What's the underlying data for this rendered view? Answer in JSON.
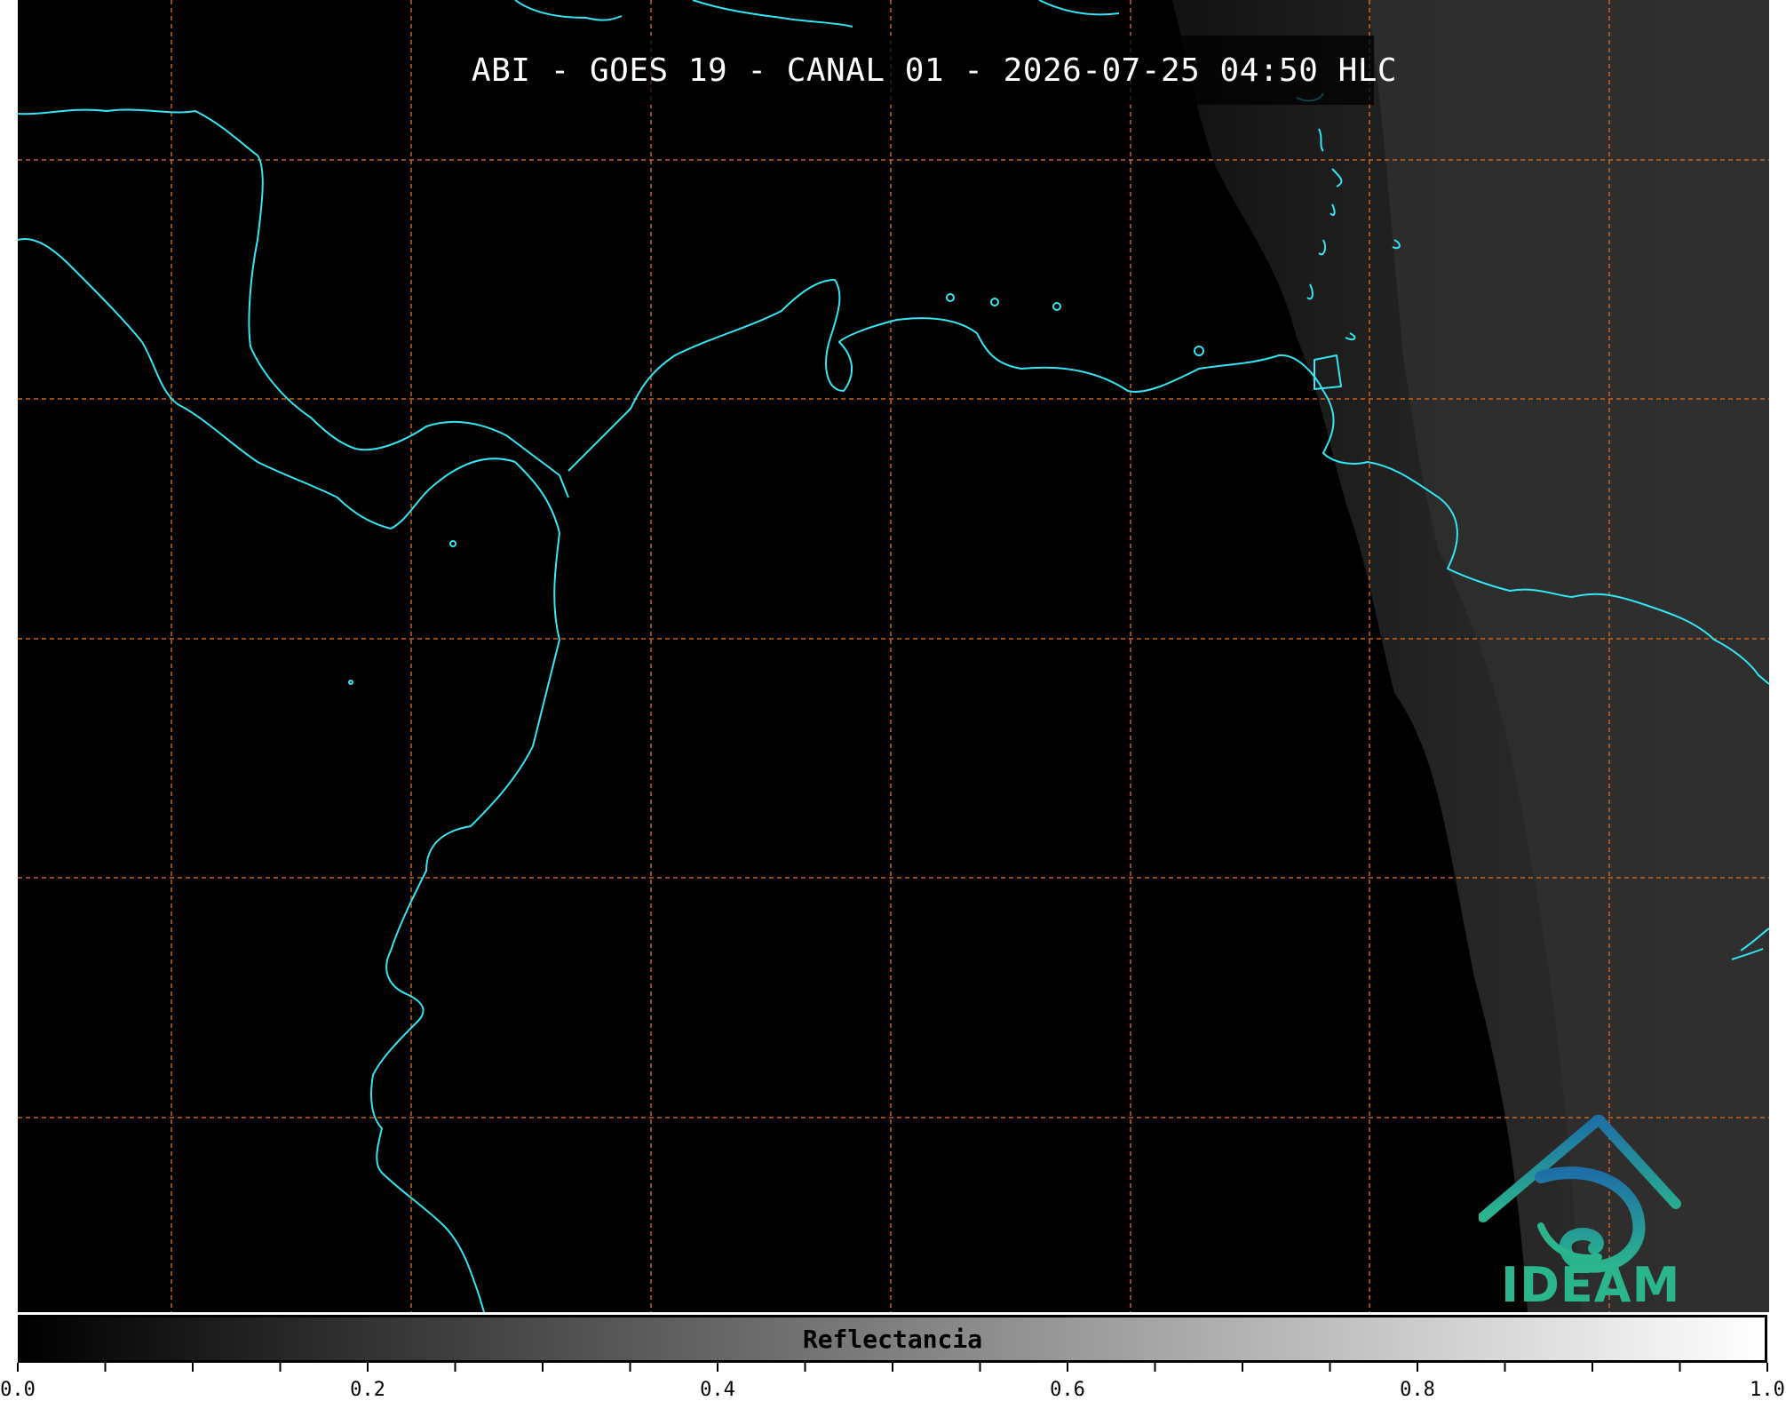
{
  "title": "ABI - GOES 19 - CANAL 01 - 2026-07-25 04:50 HLC",
  "logo": {
    "text": "IDEAM",
    "icon": "ideam-logo-icon",
    "color": "#2bb58d"
  },
  "colorbar": {
    "label": "Reflectancia",
    "range": [
      0.0,
      1.0
    ],
    "colormap": "gray",
    "major_ticks": [
      {
        "value": 0.0,
        "label": "0.0"
      },
      {
        "value": 0.2,
        "label": "0.2"
      },
      {
        "value": 0.4,
        "label": "0.4"
      },
      {
        "value": 0.6,
        "label": "0.6"
      },
      {
        "value": 0.8,
        "label": "0.8"
      },
      {
        "value": 1.0,
        "label": "1.0"
      }
    ],
    "minor_tick_step": 0.05
  },
  "map": {
    "coastline_color": "#33e6f2",
    "gridline_color": "#c8641e",
    "background": "#000000"
  }
}
